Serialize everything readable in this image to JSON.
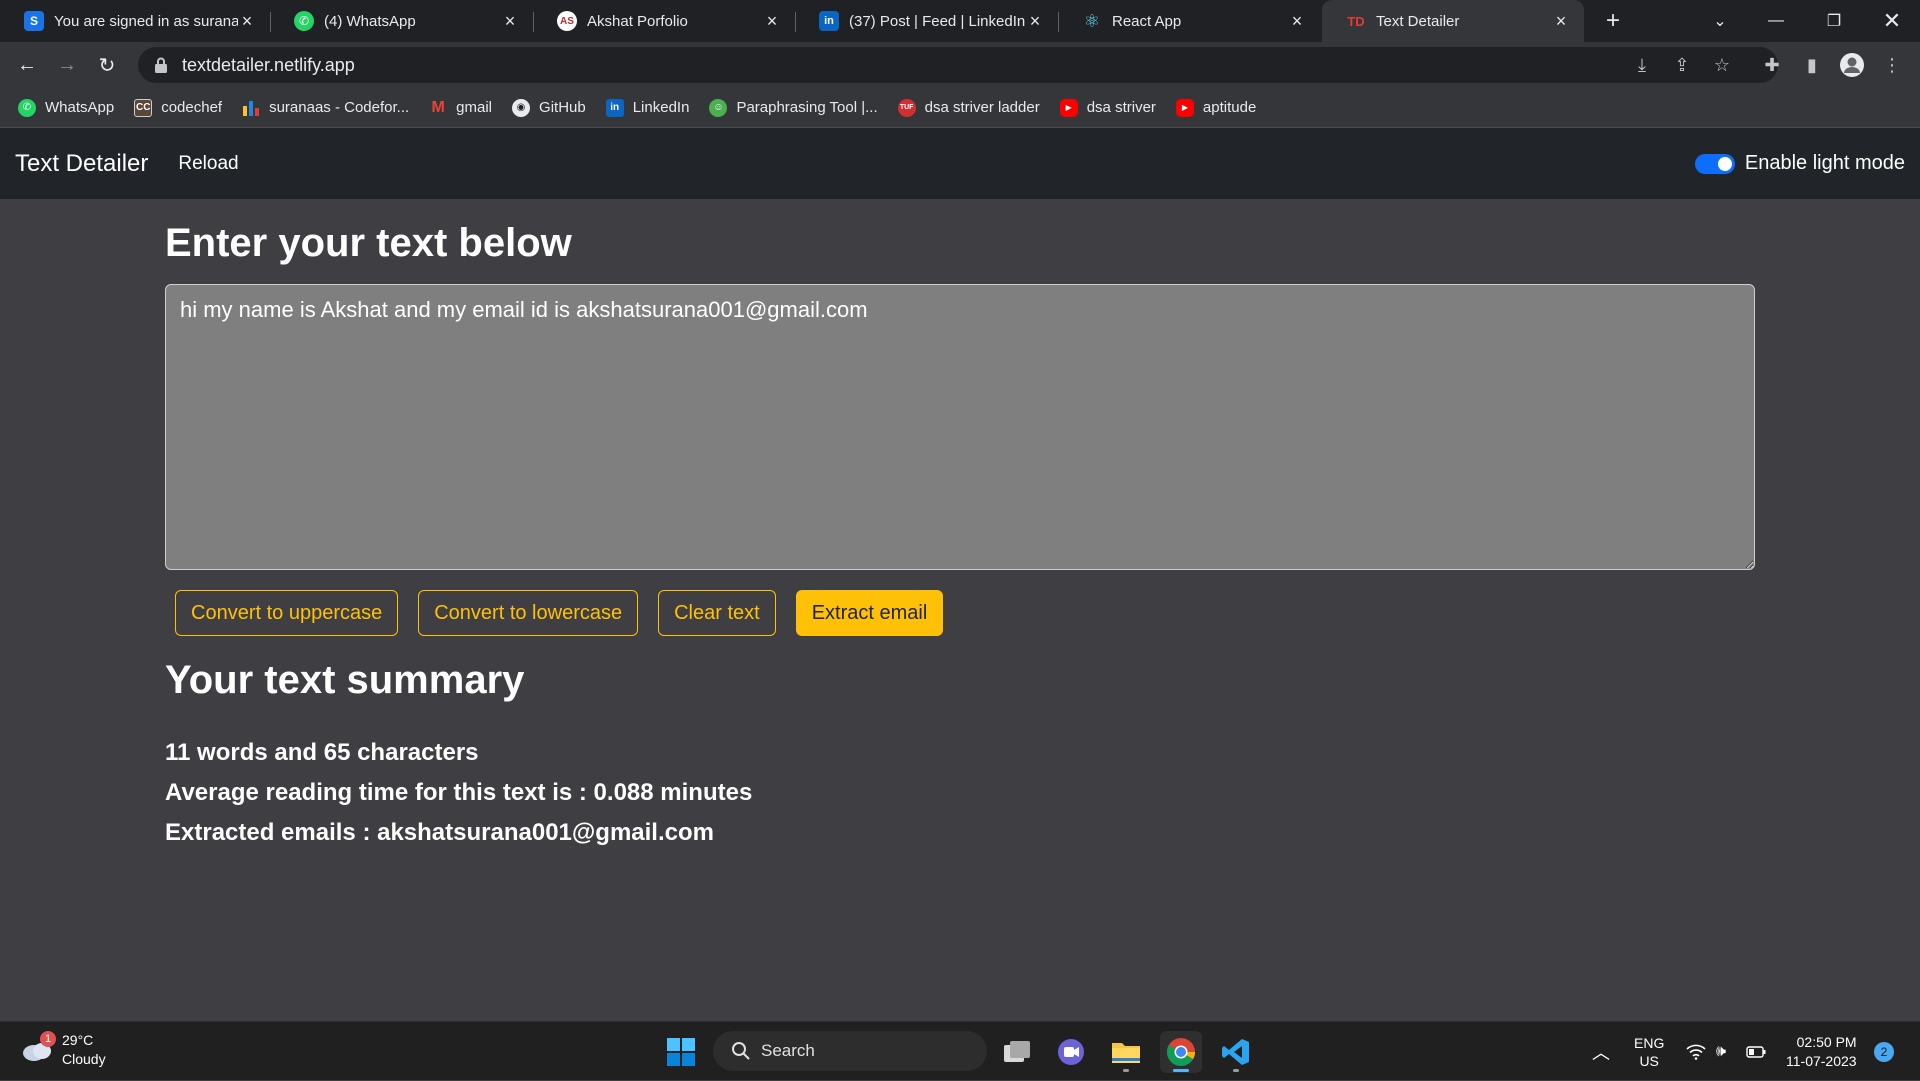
{
  "browser": {
    "tabs": [
      {
        "title": "You are signed in as surana",
        "icon": "s-logo-icon",
        "active": false
      },
      {
        "title": "(4) WhatsApp",
        "icon": "whatsapp-icon",
        "active": false
      },
      {
        "title": "Akshat Porfolio",
        "icon": "as-logo-icon",
        "active": false
      },
      {
        "title": "(37) Post | Feed | LinkedIn",
        "icon": "linkedin-icon",
        "active": false
      },
      {
        "title": "React App",
        "icon": "react-icon",
        "active": false
      },
      {
        "title": "Text Detailer",
        "icon": "td-logo-icon",
        "active": true
      }
    ],
    "url": "textdetailer.netlify.app",
    "bookmarks": [
      {
        "label": "WhatsApp",
        "icon": "whatsapp-icon"
      },
      {
        "label": "codechef",
        "icon": "codechef-icon"
      },
      {
        "label": "suranaas - Codefor...",
        "icon": "codeforces-icon"
      },
      {
        "label": "gmail",
        "icon": "gmail-icon"
      },
      {
        "label": "GitHub",
        "icon": "github-icon"
      },
      {
        "label": "LinkedIn",
        "icon": "linkedin-icon"
      },
      {
        "label": "Paraphrasing Tool |...",
        "icon": "paraphrase-icon"
      },
      {
        "label": "dsa striver ladder",
        "icon": "tuf-icon"
      },
      {
        "label": "dsa striver",
        "icon": "youtube-icon"
      },
      {
        "label": "aptitude",
        "icon": "youtube-icon"
      }
    ]
  },
  "app": {
    "brand": "Text Detailer",
    "nav_reload": "Reload",
    "mode_label": "Enable light mode",
    "mode_enabled": true,
    "input_heading": "Enter your text below",
    "textarea_value": "hi my name is Akshat and my email id is akshatsurana001@gmail.com",
    "buttons": {
      "uppercase": "Convert to uppercase",
      "lowercase": "Convert to lowercase",
      "clear": "Clear text",
      "extract": "Extract email"
    },
    "summary_heading": "Your text summary",
    "summary": {
      "counts": "11 words and 65 characters",
      "reading_time": "Average reading time for this text is : 0.088 minutes",
      "emails": "Extracted emails : akshatsurana001@gmail.com"
    },
    "colors": {
      "accent": "#ffc107",
      "navbar": "#212529",
      "background": "#3f3e43",
      "textarea": "#7f7f7f",
      "toggle": "#0d6efd"
    }
  },
  "taskbar": {
    "weather_temp": "29°C",
    "weather_desc": "Cloudy",
    "weather_badge": "1",
    "search_placeholder": "Search",
    "lang_top": "ENG",
    "lang_bottom": "US",
    "time": "02:50 PM",
    "date": "11-07-2023",
    "notification_count": "2"
  }
}
